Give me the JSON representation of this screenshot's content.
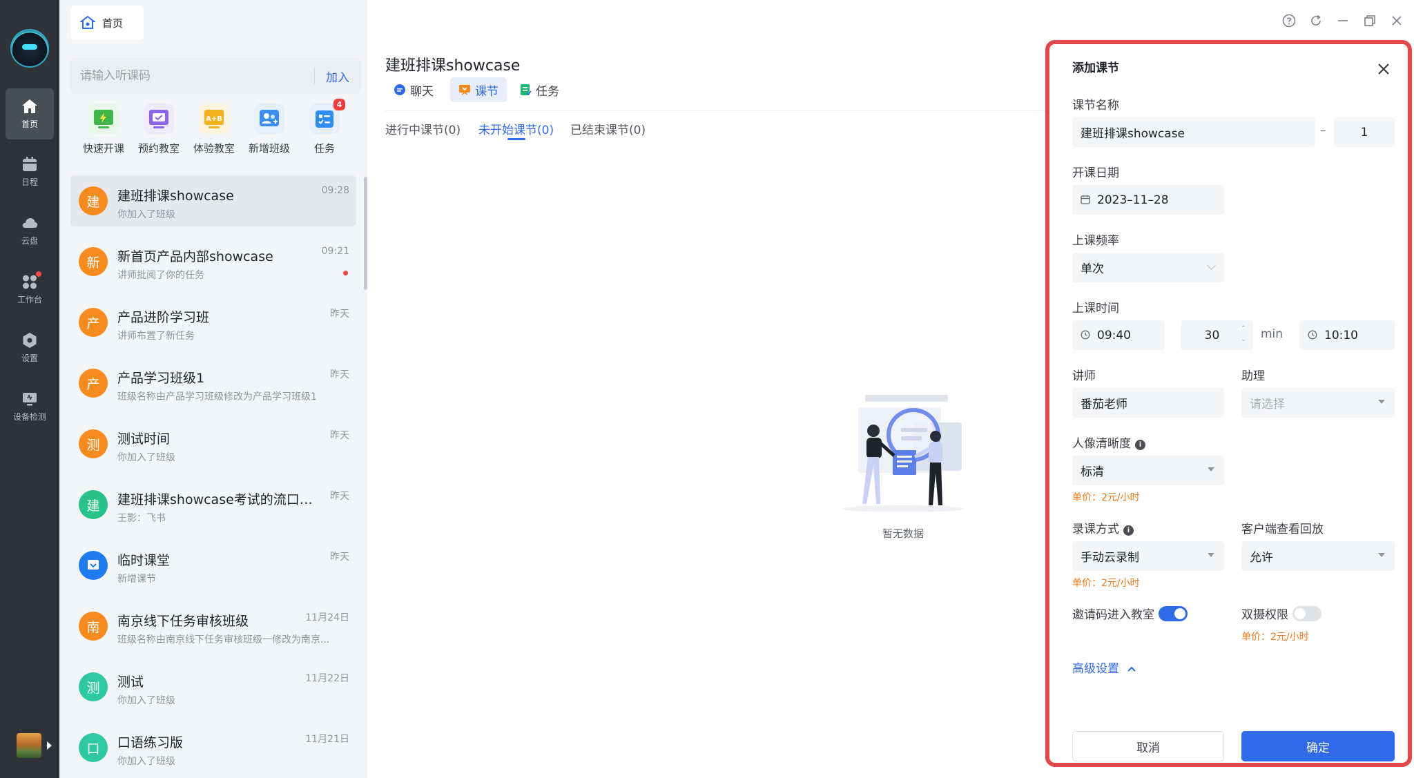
{
  "rail": {
    "nav": [
      {
        "label": "首页",
        "icon": "home-icon",
        "active": true
      },
      {
        "label": "日程",
        "icon": "calendar-icon",
        "active": false
      },
      {
        "label": "云盘",
        "icon": "cloud-icon",
        "active": false
      },
      {
        "label": "工作台",
        "icon": "workbench-icon",
        "active": false,
        "dot": true
      },
      {
        "label": "设置",
        "icon": "settings-icon",
        "active": false
      },
      {
        "label": "设备检测",
        "icon": "device-check-icon",
        "active": false
      }
    ]
  },
  "home_tab": {
    "label": "首页"
  },
  "search": {
    "placeholder": "请输入听课码",
    "join_label": "加入"
  },
  "quick_actions": [
    {
      "label": "快速开课",
      "icon": "quick-start-icon",
      "color": "#3fb54b"
    },
    {
      "label": "预约教室",
      "icon": "book-room-icon",
      "color": "#8a63e8"
    },
    {
      "label": "体验教室",
      "icon": "trial-room-icon",
      "color": "#f2b21f"
    },
    {
      "label": "新增班级",
      "icon": "add-class-icon",
      "color": "#3b8ef0"
    },
    {
      "label": "任务",
      "icon": "task-icon",
      "color": "#2f8cf0",
      "badge": "4"
    }
  ],
  "chats": [
    {
      "avatar": "建",
      "name": "建班排课showcase",
      "sub": "你加入了班级",
      "time": "09:28",
      "color": "#f58a1f",
      "selected": true
    },
    {
      "avatar": "新",
      "name": "新首页产品内部showcase",
      "sub": "讲师批阅了你的任务",
      "time": "09:21",
      "color": "#f58a1f",
      "unread": true
    },
    {
      "avatar": "产",
      "name": "产品进阶学习班",
      "sub": "讲师布置了新任务",
      "time": "昨天",
      "color": "#f58a1f"
    },
    {
      "avatar": "产",
      "name": "产品学习班级1",
      "sub": "班级名称由产品学习班级修改为产品学习班级1",
      "time": "昨天",
      "color": "#f58a1f"
    },
    {
      "avatar": "测",
      "name": "测试时间",
      "sub": "你加入了班级",
      "time": "昨天",
      "color": "#f58a1f"
    },
    {
      "avatar": "建",
      "name": "建班排课showcase考试的流口水...",
      "sub": "王影：飞书",
      "time": "昨天",
      "color": "#28c28a"
    },
    {
      "avatar": "",
      "name": "临时课堂",
      "sub": "新增课节",
      "time": "昨天",
      "color": "#1e7cf0",
      "icon": "temp-classroom-icon"
    },
    {
      "avatar": "南",
      "name": "南京线下任务审核班级",
      "sub": "班级名称由南京线下任务审核班级一修改为南京...",
      "time": "11月24日",
      "color": "#f58a1f"
    },
    {
      "avatar": "测",
      "name": "测试",
      "sub": "你加入了班级",
      "time": "11月22日",
      "color": "#2ec9a2"
    },
    {
      "avatar": "口",
      "name": "口语练习版",
      "sub": "你加入了班级",
      "time": "11月21日",
      "color": "#2ec9a2"
    }
  ],
  "main": {
    "title": "建班排课showcase",
    "tabs": [
      {
        "label": "聊天",
        "icon": "chat-icon",
        "active": false
      },
      {
        "label": "课节",
        "icon": "lesson-icon",
        "active": true
      },
      {
        "label": "任务",
        "icon": "task-list-icon",
        "active": false
      }
    ],
    "subtabs": [
      {
        "label": "进行中课节(0)",
        "active": false
      },
      {
        "label": "未开始课节(0)",
        "active": true
      },
      {
        "label": "已结束课节(0)",
        "active": false
      }
    ],
    "empty_label": "暂无数据"
  },
  "window_controls": [
    "help-icon",
    "refresh-icon",
    "minimize-icon",
    "restore-icon",
    "close-icon"
  ],
  "dialog": {
    "title": "添加课节",
    "name_label": "课节名称",
    "name_value": "建班排课showcase",
    "name_sep": "–",
    "name_suffix": "1",
    "date_label": "开课日期",
    "date_value": "2023–11–28",
    "freq_label": "上课频率",
    "freq_value": "单次",
    "time_label": "上课时间",
    "start_time": "09:40",
    "duration": "30",
    "duration_unit": "min",
    "end_time": "10:10",
    "teacher_label": "讲师",
    "teacher_value": "番茄老师",
    "assistant_label": "助理",
    "assistant_placeholder": "请选择",
    "clarity_label": "人像清晰度",
    "clarity_value": "标清",
    "clarity_price": "单价：2元/小时",
    "record_label": "录课方式",
    "record_value": "手动云录制",
    "record_price": "单价：2元/小时",
    "replay_label": "客户端查看回放",
    "replay_value": "允许",
    "invite_label": "邀请码进入教室",
    "invite_on": true,
    "dual_label": "双摄权限",
    "dual_on": false,
    "dual_price": "单价：2元/小时",
    "advanced_label": "高级设置",
    "cancel_label": "取消",
    "ok_label": "确定"
  }
}
